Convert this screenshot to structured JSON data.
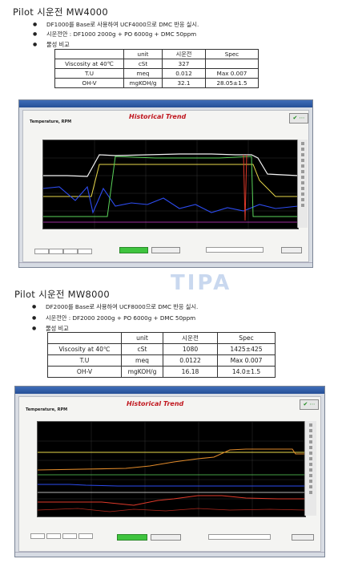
{
  "section1": {
    "title": "Pilot 시운전 MW4000",
    "bullets": [
      "DF1000를 Base로 사용하여 UCF4000으로 DMC 반응 실시.",
      "시운전안 : DF1000 2000g + PO 6000g + DMC 50ppm",
      "물성 비교"
    ],
    "table": {
      "header": [
        "",
        "unit",
        "시운전",
        "Spec"
      ],
      "rows": [
        [
          "Viscosity at 40℃",
          "cSt",
          "327",
          ""
        ],
        [
          "T.U",
          "meq",
          "0.012",
          "Max 0.007"
        ],
        [
          "OH-V",
          "mgKOH/g",
          "32.1",
          "28.05±1.5"
        ]
      ]
    },
    "screen": {
      "trend_title": "Historical Trend",
      "panel_label": "Temperature, RPM"
    }
  },
  "section2": {
    "title": "Pilot 시운전 MW8000",
    "bullets": [
      "DF2000를 Base로 사용하여 UCF8000으로 DMC 반응 실시.",
      "시운전안 : DF2000 2000g + PO 6000g + DMC 50ppm",
      "물성 비교"
    ],
    "table": {
      "header": [
        "",
        "unit",
        "시운전",
        "Spec"
      ],
      "rows": [
        [
          "Viscosity at 40℃",
          "cSt",
          "1080",
          "1425±425"
        ],
        [
          "T.U",
          "meq",
          "0.0122",
          "Max 0.007"
        ],
        [
          "OH-V",
          "mgKOH/g",
          "16.18",
          "14.0±1.5"
        ]
      ]
    },
    "screen": {
      "trend_title": "Historical Trend",
      "panel_label": "Temperature, RPM"
    }
  },
  "watermark": "TIPA",
  "colors": {
    "chart_bg": "#000000",
    "trend_title": "#c0171f",
    "line_white": "#f2f2f2",
    "line_yellow": "#e8d84a",
    "line_blue": "#2d4cf0",
    "line_red": "#e03a2a",
    "line_green": "#5ad35a",
    "line_orange": "#e08a2a",
    "line_magenta": "#d23ad2"
  }
}
